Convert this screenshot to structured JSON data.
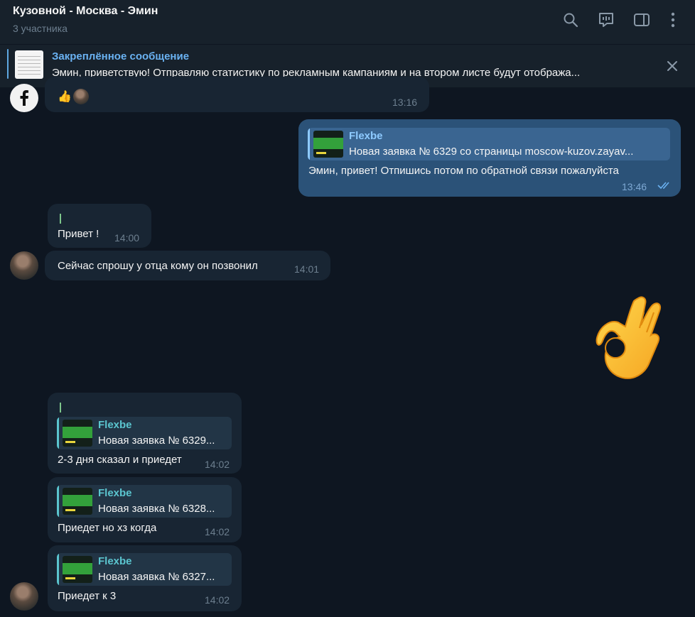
{
  "header": {
    "title": "Кузовной - Москва - Эмин",
    "subtitle": "3 участника",
    "icons": [
      "search-icon",
      "video-chat-icon",
      "sidebar-toggle-icon",
      "more-vertical-icon"
    ]
  },
  "pinned": {
    "title": "Закреплённое сообщение",
    "text": "Эмин, приветствую! Отправляю статистику по рекламным кампаниям и на втором листе будут отобража..."
  },
  "messages": [
    {
      "id": "m1",
      "direction": "in",
      "sender_avatar": "facebook-logo",
      "reactions": [
        "👍"
      ],
      "time": "13:16"
    },
    {
      "id": "m2",
      "direction": "out",
      "reply_to": {
        "name": "Flexbe",
        "text": "Новая заявка № 6329 со страницы moscow-kuzov.zayav..."
      },
      "text": "Эмин, привет! Отпишись потом по обратной связи пожалуйста",
      "time": "13:46",
      "status": "read"
    },
    {
      "id": "m3",
      "direction": "in",
      "text": "Привет !",
      "time": "14:00"
    },
    {
      "id": "m4",
      "direction": "in",
      "text": "Сейчас спрошу у отца кому он позвонил",
      "time": "14:01"
    },
    {
      "id": "m5",
      "direction": "out",
      "type": "sticker",
      "emoji": "ok-hand"
    },
    {
      "id": "m6",
      "direction": "in",
      "reply_to": {
        "name": "Flexbe",
        "text": "Новая заявка № 6329..."
      },
      "text": "2-3 дня сказал и приедет",
      "time": "14:02"
    },
    {
      "id": "m7",
      "direction": "in",
      "reply_to": {
        "name": "Flexbe",
        "text": "Новая заявка № 6328..."
      },
      "text": "Приедет но хз когда",
      "time": "14:02"
    },
    {
      "id": "m8",
      "direction": "in",
      "reply_to": {
        "name": "Flexbe",
        "text": "Новая заявка № 6327..."
      },
      "text": "Приедет к 3",
      "time": "14:02"
    }
  ],
  "colors": {
    "background": "#0e1621",
    "header": "#17212b",
    "incoming_bubble": "#182533",
    "outgoing_bubble": "#2b5278",
    "accent": "#6ab2f2"
  }
}
